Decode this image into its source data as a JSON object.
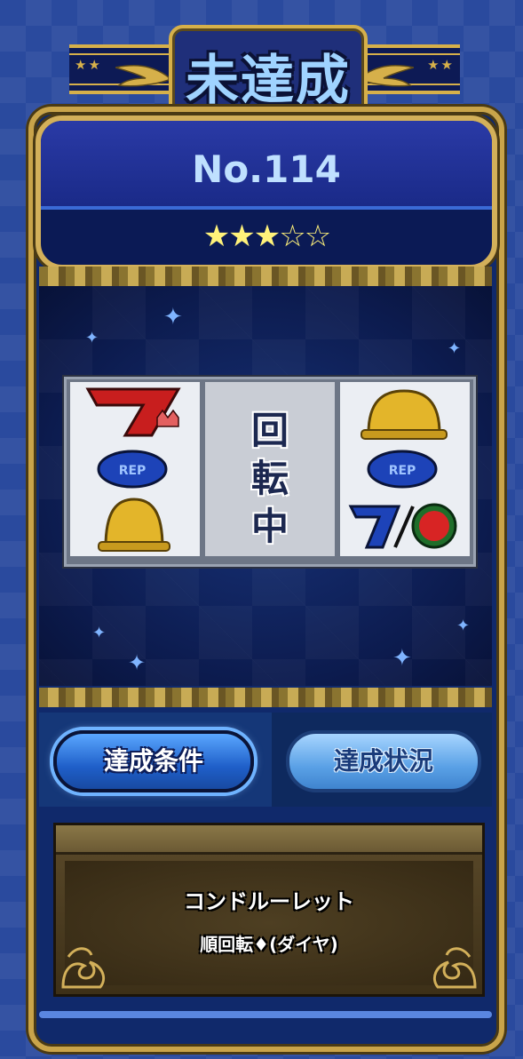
{
  "header": {
    "status_title": "未達成",
    "number": "No.114",
    "rating_text": "★★★☆☆",
    "stars_filled": 3,
    "stars_total": 5
  },
  "reels": {
    "left": [
      "red-seven-crown-icon",
      "blue-replay-icon",
      "gold-bell-icon"
    ],
    "center_status": "回\n転\n中",
    "right": [
      "gold-bell-icon",
      "blue-replay-icon",
      "blue-seven-watermelon-icon"
    ]
  },
  "tabs": [
    {
      "label": "達成条件",
      "active": true
    },
    {
      "label": "達成状況",
      "active": false
    }
  ],
  "condition": {
    "line1": "コンドルーレット",
    "line2": "順回転♦(ダイヤ)"
  },
  "colors": {
    "gold": "#d3b05a",
    "navy": "#0b1a55",
    "title_blue": "#9fd3ff",
    "star_yellow": "#fff27a"
  }
}
